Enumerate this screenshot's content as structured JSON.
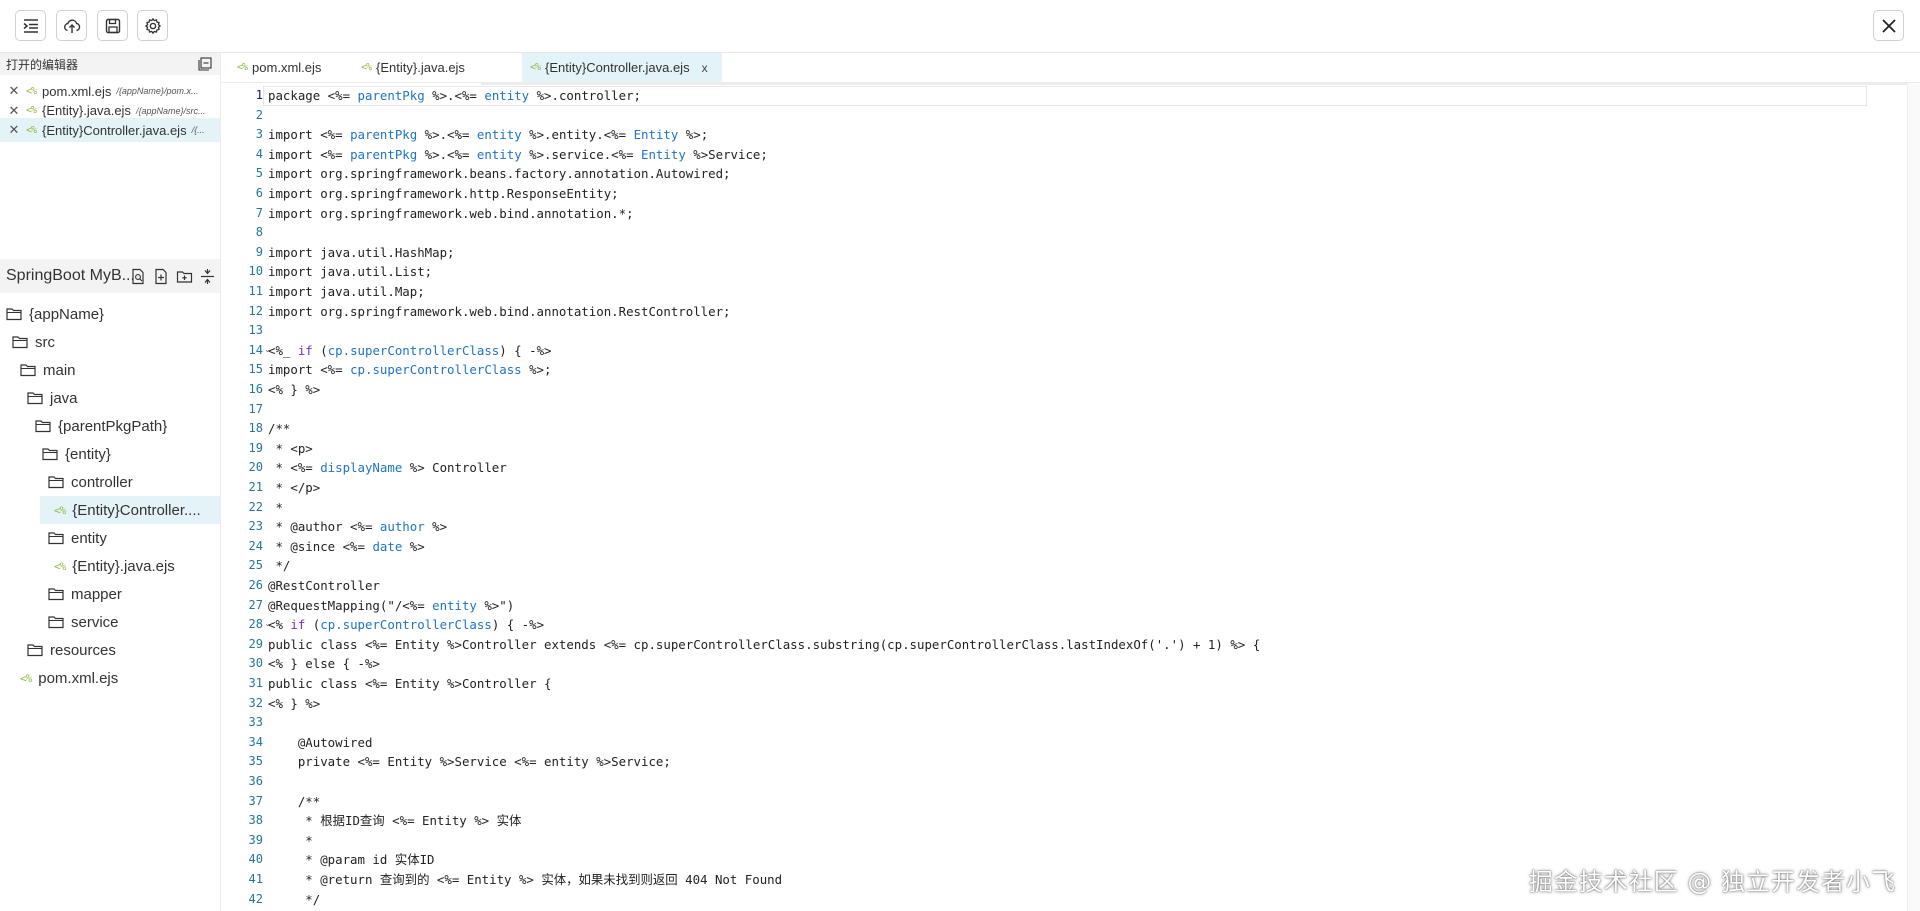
{
  "toolbar": {
    "buttons": [
      {
        "name": "outline",
        "icon": "list-indent-icon"
      },
      {
        "name": "upload",
        "icon": "cloud-upload-icon"
      },
      {
        "name": "save",
        "icon": "save-icon"
      },
      {
        "name": "settings",
        "icon": "gear-icon"
      }
    ],
    "close_icon": "close-icon"
  },
  "open_editors": {
    "title": "打开的编辑器",
    "items": [
      {
        "name": "pom.xml.ejs",
        "path": "/{appName}/pom.x...",
        "active": false
      },
      {
        "name": "{Entity}.java.ejs",
        "path": "/{appName}/src...",
        "active": false
      },
      {
        "name": "{Entity}Controller.java.ejs",
        "path": "/{...",
        "active": true
      }
    ]
  },
  "project": {
    "title": "SpringBoot MyB...",
    "tree": [
      {
        "label": "{appName}",
        "type": "folder"
      },
      {
        "label": "src",
        "type": "folder"
      },
      {
        "label": "main",
        "type": "folder"
      },
      {
        "label": "java",
        "type": "folder"
      },
      {
        "label": "{parentPkgPath}",
        "type": "folder"
      },
      {
        "label": "{entity}",
        "type": "folder"
      },
      {
        "label": "controller",
        "type": "folder"
      },
      {
        "label": "{Entity}Controller....",
        "type": "file",
        "active": true
      },
      {
        "label": "entity",
        "type": "folder"
      },
      {
        "label": "{Entity}.java.ejs",
        "type": "file"
      },
      {
        "label": "mapper",
        "type": "folder"
      },
      {
        "label": "service",
        "type": "folder"
      },
      {
        "label": "resources",
        "type": "folder"
      },
      {
        "label": "pom.xml.ejs",
        "type": "file"
      }
    ]
  },
  "tabs": [
    {
      "label": "pom.xml.ejs",
      "active": false
    },
    {
      "label": "{Entity}.java.ejs",
      "active": false
    },
    {
      "label": "{Entity}Controller.java.ejs",
      "active": true,
      "close": "x"
    }
  ],
  "editor": {
    "current_line": 1,
    "fold_lines": [
      14,
      28
    ],
    "lines": [
      [
        {
          "t": "package <%= "
        },
        {
          "t": "parentPkg",
          "c": "v"
        },
        {
          "t": " %>.<%= "
        },
        {
          "t": "entity",
          "c": "v"
        },
        {
          "t": " %>.controller;"
        }
      ],
      [],
      [
        {
          "t": "import <%= "
        },
        {
          "t": "parentPkg",
          "c": "v"
        },
        {
          "t": " %>.<%= "
        },
        {
          "t": "entity",
          "c": "v"
        },
        {
          "t": " %>.entity.<%= "
        },
        {
          "t": "Entity",
          "c": "v"
        },
        {
          "t": " %>;"
        }
      ],
      [
        {
          "t": "import <%= "
        },
        {
          "t": "parentPkg",
          "c": "v"
        },
        {
          "t": " %>.<%= "
        },
        {
          "t": "entity",
          "c": "v"
        },
        {
          "t": " %>.service.<%= "
        },
        {
          "t": "Entity",
          "c": "v"
        },
        {
          "t": " %>Service;"
        }
      ],
      [
        {
          "t": "import org.springframework.beans.factory.annotation.Autowired;"
        }
      ],
      [
        {
          "t": "import org.springframework.http.ResponseEntity;"
        }
      ],
      [
        {
          "t": "import org.springframework.web.bind.annotation.*;"
        }
      ],
      [],
      [
        {
          "t": "import java.util.HashMap;"
        }
      ],
      [
        {
          "t": "import java.util.List;"
        }
      ],
      [
        {
          "t": "import java.util.Map;"
        }
      ],
      [
        {
          "t": "import org.springframework.web.bind.annotation.RestController;"
        }
      ],
      [],
      [
        {
          "t": "<%_ "
        },
        {
          "t": "if",
          "c": "kw"
        },
        {
          "t": " ("
        },
        {
          "t": "cp.superControllerClass",
          "c": "v"
        },
        {
          "t": ") { -%>"
        }
      ],
      [
        {
          "t": "import <%= "
        },
        {
          "t": "cp.superControllerClass",
          "c": "v"
        },
        {
          "t": " %>;"
        }
      ],
      [
        {
          "t": "<% } %>"
        }
      ],
      [],
      [
        {
          "t": "/**"
        }
      ],
      [
        {
          "t": " * <p>"
        }
      ],
      [
        {
          "t": " * <%= "
        },
        {
          "t": "displayName",
          "c": "v"
        },
        {
          "t": " %> Controller"
        }
      ],
      [
        {
          "t": " * </p>"
        }
      ],
      [
        {
          "t": " *"
        }
      ],
      [
        {
          "t": " * @author <%= "
        },
        {
          "t": "author",
          "c": "v"
        },
        {
          "t": " %>"
        }
      ],
      [
        {
          "t": " * @since <%= "
        },
        {
          "t": "date",
          "c": "v"
        },
        {
          "t": " %>"
        }
      ],
      [
        {
          "t": " */"
        }
      ],
      [
        {
          "t": "@RestController"
        }
      ],
      [
        {
          "t": "@RequestMapping(\"/<%= "
        },
        {
          "t": "entity",
          "c": "v"
        },
        {
          "t": " %>\")"
        }
      ],
      [
        {
          "t": "<% "
        },
        {
          "t": "if",
          "c": "kw"
        },
        {
          "t": " ("
        },
        {
          "t": "cp.superControllerClass",
          "c": "v"
        },
        {
          "t": ") { -%>"
        }
      ],
      [
        {
          "t": "public class <%= Entity %>Controller extends <%= cp.superControllerClass.substring(cp.superControllerClass.lastIndexOf('.') + 1) %> {"
        }
      ],
      [
        {
          "t": "<% } else { -%>"
        }
      ],
      [
        {
          "t": "public class <%= Entity %>Controller {"
        }
      ],
      [
        {
          "t": "<% } %>"
        }
      ],
      [],
      [
        {
          "t": "    @Autowired"
        }
      ],
      [
        {
          "t": "    private <%= Entity %>Service <%= entity %>Service;"
        }
      ],
      [],
      [
        {
          "t": "    /**"
        }
      ],
      [
        {
          "t": "     * 根据ID查询 <%= Entity %> 实体"
        }
      ],
      [
        {
          "t": "     *"
        }
      ],
      [
        {
          "t": "     * @param id 实体ID"
        }
      ],
      [
        {
          "t": "     * @return 查询到的 <%= Entity %> 实体，如果未找到则返回 404 Not Found"
        }
      ],
      [
        {
          "t": "     */"
        }
      ]
    ]
  },
  "watermark": "掘金技术社区 @ 独立开发者小飞"
}
